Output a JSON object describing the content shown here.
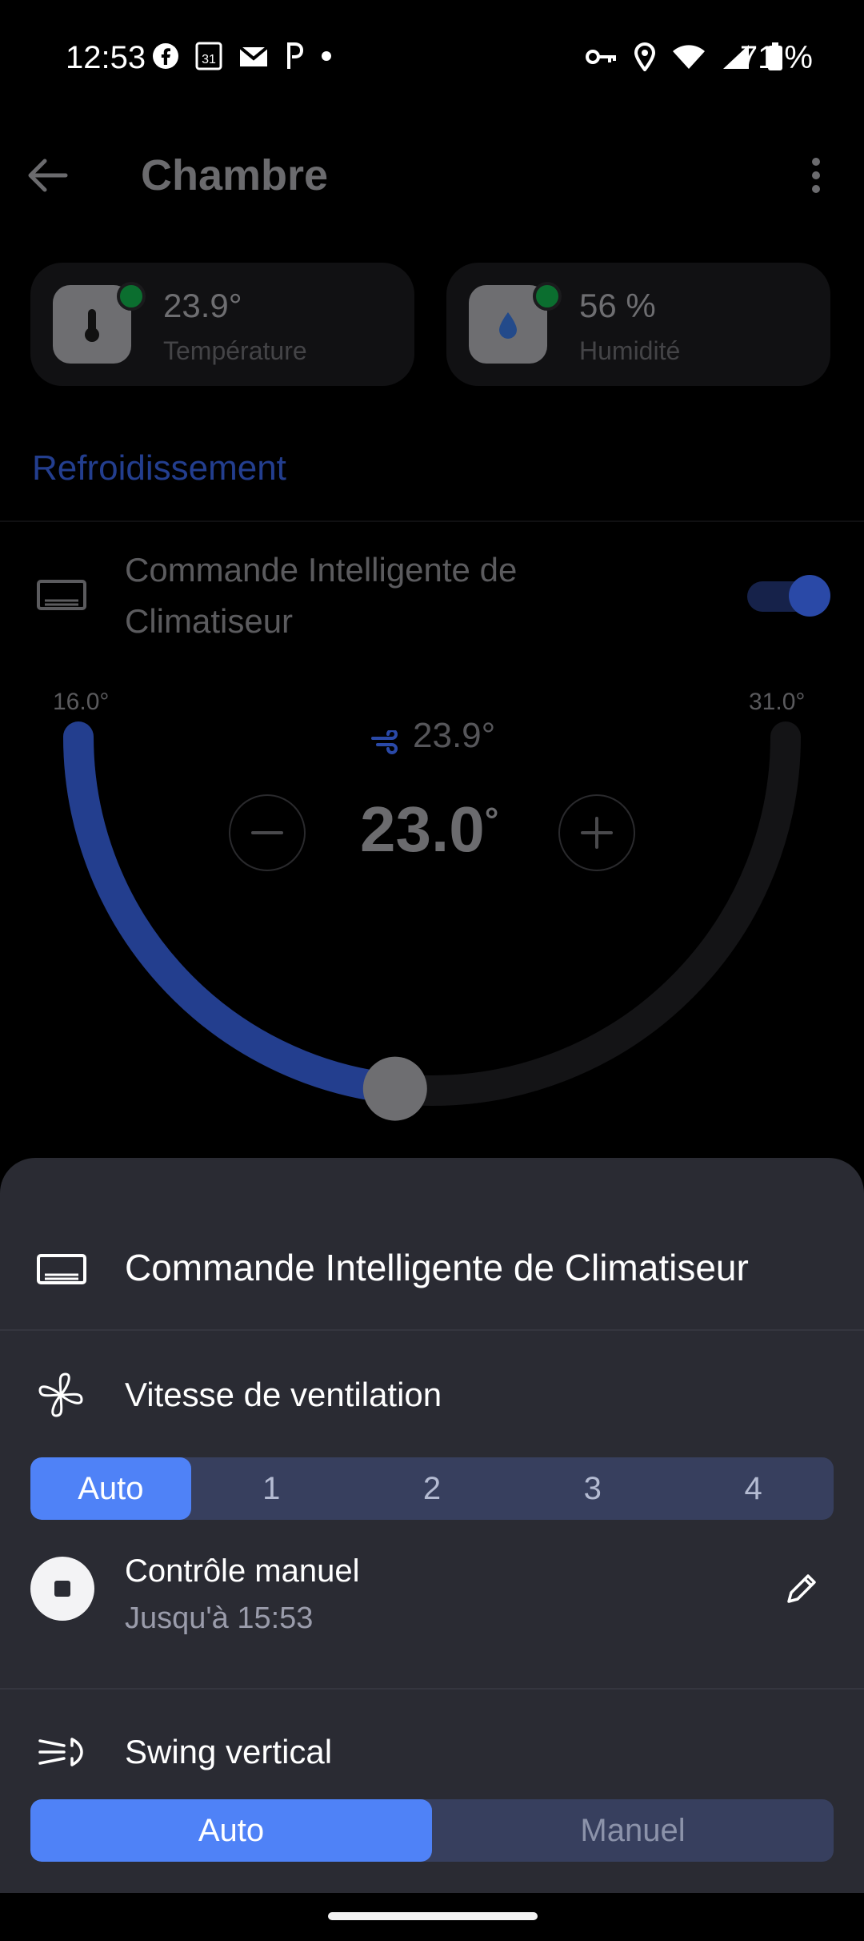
{
  "status_bar": {
    "time": "12:53",
    "battery": "71 %",
    "left_icons": [
      "facebook-icon",
      "calendar-icon",
      "gmail-icon",
      "p-icon",
      "dot-icon"
    ],
    "right_icons": [
      "vpn-key-icon",
      "location-icon",
      "wifi-icon",
      "signal-icon",
      "battery-icon"
    ],
    "calendar_day": "31"
  },
  "app_bar": {
    "title": "Chambre"
  },
  "sensors": [
    {
      "value": "23.9°",
      "label": "Température",
      "icon": "thermometer-icon"
    },
    {
      "value": "56 %",
      "label": "Humidité",
      "icon": "droplet-icon"
    }
  ],
  "section": {
    "title": "Refroidissement"
  },
  "device": {
    "name": "Commande Intelligente de Climatiseur",
    "enabled": true
  },
  "dial": {
    "min": "16.0°",
    "max": "31.0°",
    "current": "23.9°",
    "target": "23.0",
    "target_unit": "°",
    "min_value": 16.0,
    "max_value": 31.0,
    "target_value": 23.0,
    "active_color": "#233e8e"
  },
  "sheet": {
    "title": "Commande Intelligente de Climatiseur",
    "fan_speed": {
      "label": "Vitesse de ventilation",
      "options": [
        "Auto",
        "1",
        "2",
        "3",
        "4"
      ],
      "selected": "Auto"
    },
    "manual": {
      "title": "Contrôle manuel",
      "subtitle": "Jusqu'à 15:53"
    },
    "swing": {
      "label": "Swing vertical",
      "options": [
        "Auto",
        "Manuel"
      ],
      "selected": "Auto"
    },
    "accent_color": "#4f82f7"
  }
}
